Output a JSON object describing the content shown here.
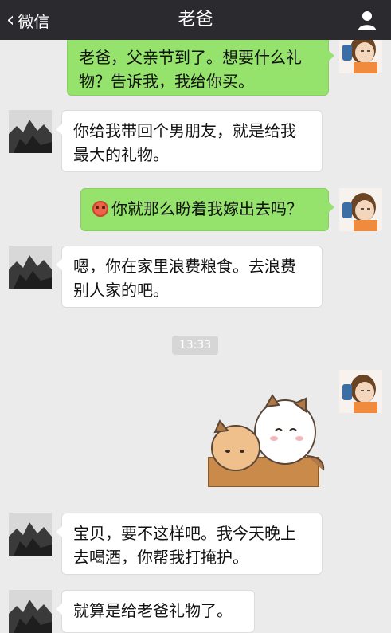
{
  "header": {
    "back_label": "微信",
    "title": "老爸"
  },
  "messages": [
    {
      "side": "right",
      "text": "老爸，父亲节到了。想要什么礼物？告诉我，我给你买。"
    },
    {
      "side": "left",
      "text": "你给我带回个男朋友，就是给我最大的礼物。"
    },
    {
      "side": "right",
      "emoji": "angry-face-emoji",
      "text": "你就那么盼着我嫁出去吗？"
    },
    {
      "side": "left",
      "text": "嗯，你在家里浪费粮食。去浪费别人家的吧。"
    },
    {
      "side": "right",
      "sticker": "hugging-cats-sticker"
    },
    {
      "side": "left",
      "text": "宝贝，要不这样吧。我今天晚上去喝酒，你帮我打掩护。"
    },
    {
      "side": "left",
      "text": "就算是给老爸礼物了。"
    }
  ],
  "timestamp": "13:33",
  "colors": {
    "topbar": "#2b2b2f",
    "chat_bg": "#ebebeb",
    "sent_bubble": "#95e36c",
    "received_bubble": "#ffffff"
  }
}
